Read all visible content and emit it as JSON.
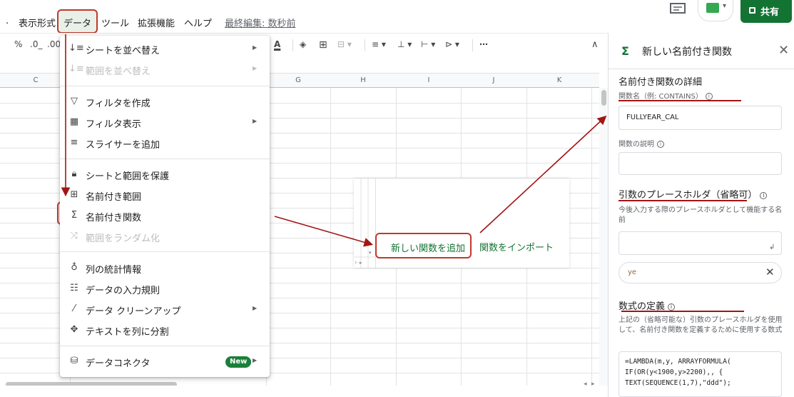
{
  "menubar": {
    "dot": ".",
    "view": "表示形式",
    "data": "データ",
    "tools": "ツール",
    "extensions": "拡張機能",
    "help": "ヘルプ",
    "last_edit": "最終編集: 数秒前",
    "share": "共有"
  },
  "toolbar": {
    "percent": "%",
    "dec_decrease": ".0_",
    "dec_increase": ".00",
    "text_color": "A",
    "more": "⋯",
    "collapse": "∧"
  },
  "columns": [
    "C",
    "G",
    "H",
    "I",
    "J",
    "K"
  ],
  "data_menu": {
    "items": [
      {
        "label": "シートを並べ替え",
        "icon": "sort-icon",
        "submenu": true,
        "disabled": false
      },
      {
        "label": "範囲を並べ替え",
        "icon": "sort-range-icon",
        "submenu": true,
        "disabled": true
      },
      {
        "label": "フィルタを作成",
        "icon": "filter-icon",
        "submenu": false,
        "disabled": false
      },
      {
        "label": "フィルタ表示",
        "icon": "filter-view-icon",
        "submenu": true,
        "disabled": false
      },
      {
        "label": "スライサーを追加",
        "icon": "slicer-icon",
        "submenu": false,
        "disabled": false
      },
      {
        "label": "シートと範囲を保護",
        "icon": "lock-icon",
        "submenu": false,
        "disabled": false
      },
      {
        "label": "名前付き範囲",
        "icon": "named-range-icon",
        "submenu": false,
        "disabled": false
      },
      {
        "label": "名前付き関数",
        "icon": "sigma-icon",
        "submenu": false,
        "disabled": false
      },
      {
        "label": "範囲をランダム化",
        "icon": "shuffle-icon",
        "submenu": false,
        "disabled": true
      },
      {
        "label": "列の統計情報",
        "icon": "lightbulb-icon",
        "submenu": false,
        "disabled": false
      },
      {
        "label": "データの入力規則",
        "icon": "validation-icon",
        "submenu": false,
        "disabled": false
      },
      {
        "label": "データ クリーンアップ",
        "icon": "magic-wand-icon",
        "submenu": true,
        "disabled": false
      },
      {
        "label": "テキストを列に分割",
        "icon": "split-icon",
        "submenu": false,
        "disabled": false
      },
      {
        "label": "データコネクタ",
        "icon": "database-icon",
        "submenu": true,
        "disabled": false
      }
    ],
    "new_badge": "New"
  },
  "inset": {
    "add_function": "新しい関数を追加",
    "import_function": "関数をインポート"
  },
  "side_panel": {
    "title": "新しい名前付き関数",
    "details_heading": "名前付き関数の詳細",
    "fn_name_label": "関数名（例: CONTAINS）",
    "fn_name_value": "FULLYEAR_CAL",
    "fn_desc_label": "関数の説明",
    "placeholders_heading": "引数のプレースホルダ（省略可）",
    "placeholders_help": "今後入力する際のプレースホルダとして機能する名前",
    "chip_value": "ye",
    "formula_heading": "数式の定義",
    "formula_help": "上記の（省略可能な）引数のプレースホルダを使用して、名前付き関数を定義するために使用する数式",
    "formula_lines": [
      "=LAMBDA(m,y, ARRAYFORMULA(",
      "IF(OR(y<1900,y>2200),, {",
      "TEXT(SEQUENCE(1,7),\"ddd\");"
    ]
  },
  "colors": {
    "accent_green": "#137333",
    "annotation_red": "#a31515"
  }
}
